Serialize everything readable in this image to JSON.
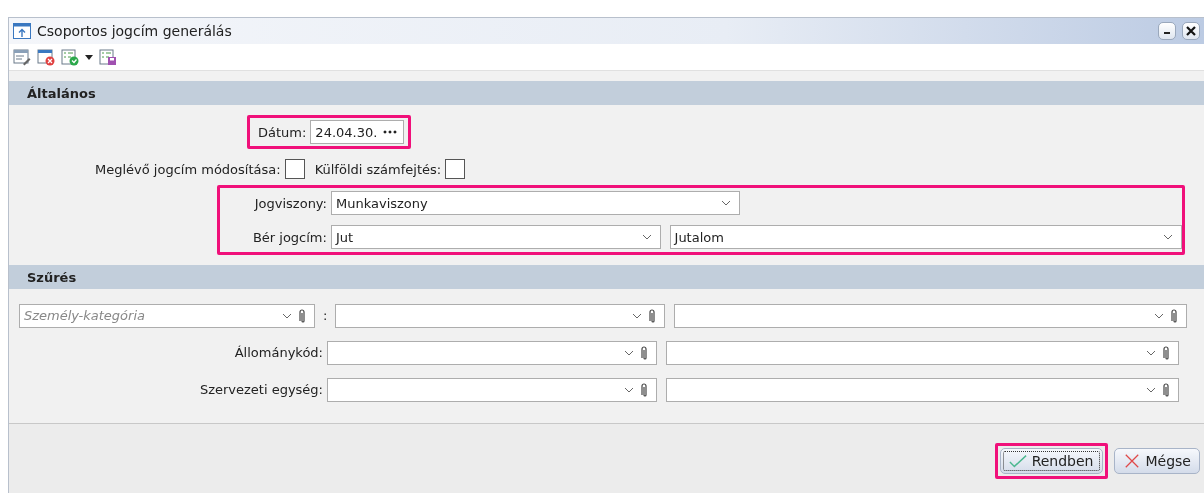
{
  "window": {
    "title": "Csoportos jogcím generálás"
  },
  "general": {
    "title": "Általános",
    "date": {
      "label": "Dátum:",
      "value": "24.04.30."
    },
    "checkboxes": [
      {
        "label": "Meglévő jogcím módosítása:",
        "checked": false
      },
      {
        "label": "Külföldi számfejtés:",
        "checked": false
      }
    ],
    "relationship": {
      "label": "Jogviszony:",
      "value": "Munkaviszony"
    },
    "wage_title": {
      "label": "Bér jogcím:",
      "code": "Jut",
      "name": "Jutalom"
    }
  },
  "filter": {
    "title": "Szűrés",
    "category": {
      "placeholder": "Személy-kategória",
      "separator": ":"
    },
    "rows": [
      {
        "label": "Állománykód:"
      },
      {
        "label": "Szervezeti egység:"
      }
    ]
  },
  "buttons": [
    {
      "label": "Rendben",
      "kind": "ok"
    },
    {
      "label": "Mégse",
      "kind": "cancel"
    }
  ]
}
